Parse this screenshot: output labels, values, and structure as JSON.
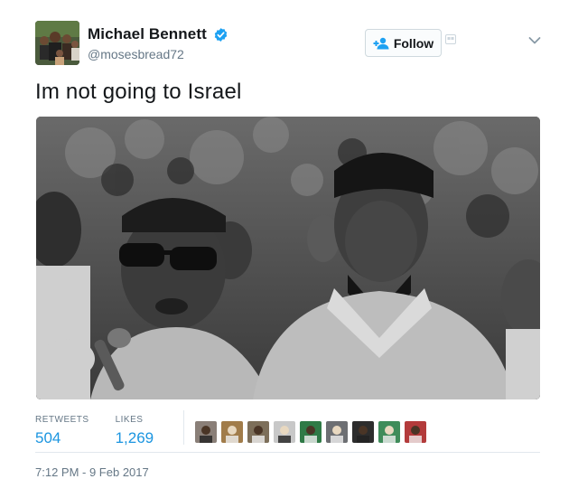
{
  "user": {
    "display_name": "Michael Bennett",
    "handle": "@mosesbread72",
    "verified": true,
    "avatar": "profile-photo-group"
  },
  "follow_button": {
    "label": "Follow",
    "icon": "add-user-icon"
  },
  "tweet": {
    "text": "Im not going to Israel",
    "media": "black-and-white-photo"
  },
  "stats": {
    "retweets_label": "RETWEETS",
    "retweets_value": "504",
    "likes_label": "LIKES",
    "likes_value": "1,269"
  },
  "likers": [
    {
      "icon": "liker-avatar-1",
      "color": "#8a7f78"
    },
    {
      "icon": "liker-avatar-2",
      "color": "#a17c4a"
    },
    {
      "icon": "liker-avatar-3",
      "color": "#7d6f5a"
    },
    {
      "icon": "liker-avatar-4",
      "color": "#c8c8c8"
    },
    {
      "icon": "liker-avatar-5",
      "color": "#2f7a46"
    },
    {
      "icon": "liker-avatar-6",
      "color": "#6d6f73"
    },
    {
      "icon": "liker-avatar-7",
      "color": "#2d2d2d"
    },
    {
      "icon": "liker-avatar-8",
      "color": "#3f8c5a"
    },
    {
      "icon": "liker-avatar-9",
      "color": "#b33b3b"
    }
  ],
  "timestamp": "7:12 PM - 9 Feb 2017",
  "colors": {
    "link_blue": "#1b95e0",
    "text_dark": "#14171a",
    "text_gray": "#657786",
    "divider": "#e1e8ed"
  }
}
